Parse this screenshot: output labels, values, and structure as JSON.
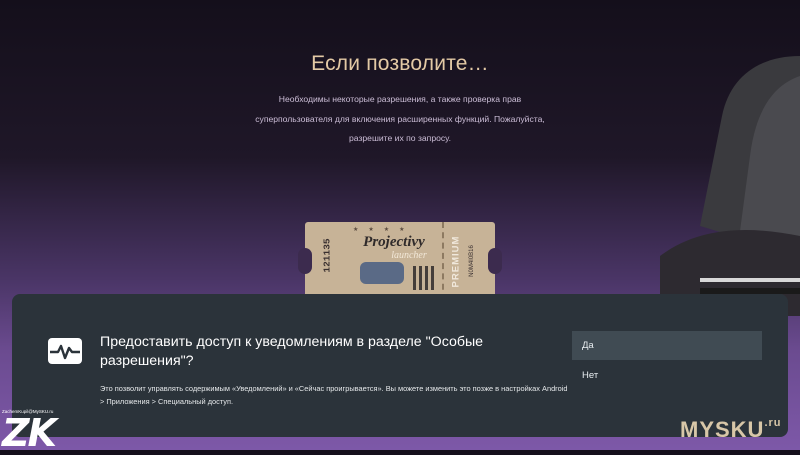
{
  "page": {
    "title": "Если позволите…",
    "description": "Необходимы некоторые разрешения, а также проверка прав суперпользователя для включения расширенных функций. Пожалуйста, разрешите их по запросу."
  },
  "ticket": {
    "serial": "121135",
    "brand": "Projectivy",
    "subtitle": "launcher",
    "badge": "PREMIUM",
    "code": "N0M4I0B16"
  },
  "dialog": {
    "icon": "notification-pulse-icon",
    "title": "Предоставить доступ к уведомлениям в разделе \"Особые разрешения\"?",
    "body": "Это позволит управлять содержимым «Уведомлений» и «Сейчас проигрывается». Вы можете изменить это позже в настройках Android > Приложения > Специальный доступ.",
    "options": {
      "yes": "Да",
      "no": "Нет"
    }
  },
  "watermarks": {
    "left_email": "ZachemKupil@MySKU.ru",
    "left_logo": "ZK",
    "right_logo": "MYSKU",
    "right_suffix": ".ru"
  },
  "colors": {
    "title": "#e3c9a5",
    "dialog_bg": "#2b333a",
    "selected_option_bg": "#404b53"
  }
}
